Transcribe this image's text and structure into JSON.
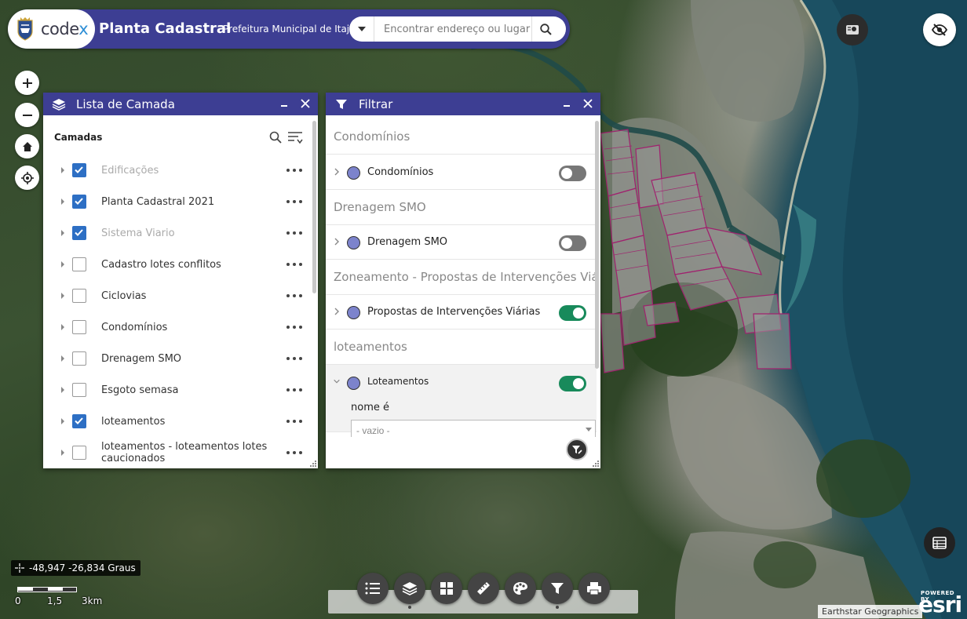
{
  "header": {
    "brand": "codex",
    "title": "Planta Cadastral",
    "subtitle": "Prefeitura Municipal de Itajaí",
    "search_placeholder": "Encontrar endereço ou lugar"
  },
  "layer_list": {
    "title": "Lista de Camada",
    "section_label": "Camadas",
    "layers": [
      {
        "name": "Edificações",
        "checked": true,
        "dimmed": true
      },
      {
        "name": "Planta Cadastral 2021",
        "checked": true,
        "dimmed": false
      },
      {
        "name": "Sistema Viario",
        "checked": true,
        "dimmed": true
      },
      {
        "name": "Cadastro lotes conflitos",
        "checked": false,
        "dimmed": false
      },
      {
        "name": "Ciclovias",
        "checked": false,
        "dimmed": false
      },
      {
        "name": "Condomínios",
        "checked": false,
        "dimmed": false
      },
      {
        "name": "Drenagem SMO",
        "checked": false,
        "dimmed": false
      },
      {
        "name": "Esgoto semasa",
        "checked": false,
        "dimmed": false
      },
      {
        "name": "loteamentos",
        "checked": true,
        "dimmed": false
      },
      {
        "name": "loteamentos - loteamentos lotes caucionados",
        "checked": false,
        "dimmed": false
      }
    ]
  },
  "filter_panel": {
    "title": "Filtrar",
    "groups": [
      {
        "heading": "Condomínios",
        "item": "Condomínios",
        "enabled": false
      },
      {
        "heading": "Drenagem SMO",
        "item": "Drenagem SMO",
        "enabled": false
      },
      {
        "heading": "Zoneamento - Propostas de Intervenções Viári...",
        "item": "Propostas de Intervenções Viárias",
        "enabled": true
      },
      {
        "heading": "loteamentos",
        "item": "Loteamentos",
        "enabled": true
      }
    ],
    "expression_label": "nome é",
    "expression_value": "- vazio -"
  },
  "map": {
    "coordinates": "-48,947 -26,834 Graus",
    "scale_labels": [
      "0",
      "1,5",
      "3km"
    ],
    "attribution": "Earthstar Geographics",
    "esri_powered": "POWERED BY",
    "esri_logo": "esri"
  },
  "colors": {
    "brand_purple": "#3d3e93",
    "toggle_on": "#188a5b",
    "checkbox_on": "#2d6fc4",
    "parcel_outline": "#a0226e"
  }
}
